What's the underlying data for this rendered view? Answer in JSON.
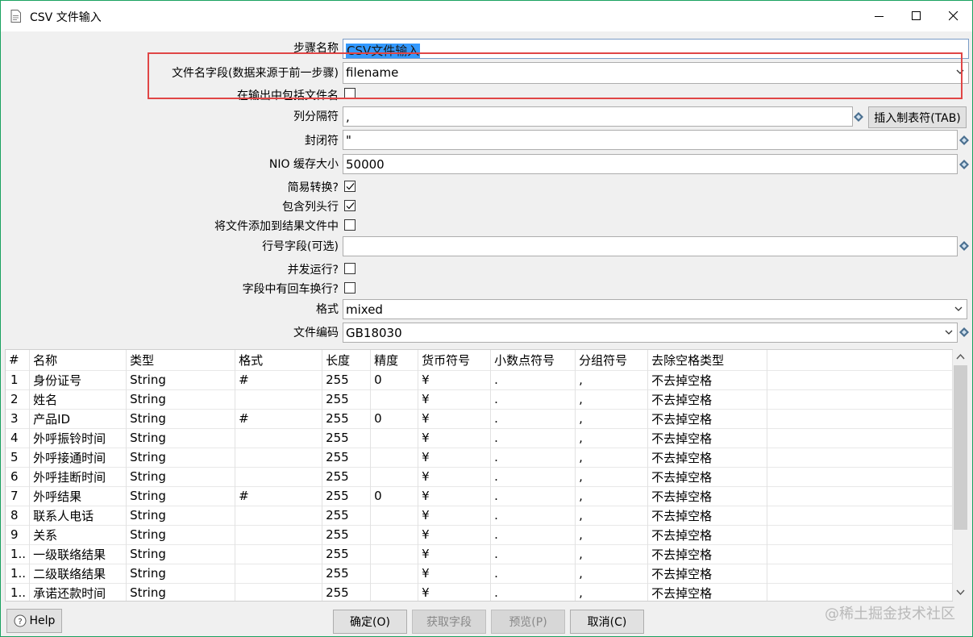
{
  "window": {
    "title": "CSV 文件输入"
  },
  "form": {
    "step_name_label": "步骤名称",
    "step_name_value": "CSV文件输入",
    "filename_field_label": "文件名字段(数据来源于前一步骤)",
    "filename_field_value": "filename",
    "include_filename_label": "在输出中包括文件名",
    "include_filename_checked": false,
    "delimiter_label": "列分隔符",
    "delimiter_value": ",",
    "insert_tab_button": "插入制表符(TAB)",
    "enclosure_label": "封闭符",
    "enclosure_value": "\"",
    "nio_buffer_label": "NIO 缓存大小",
    "nio_buffer_value": "50000",
    "lazy_conversion_label": "简易转换?",
    "lazy_conversion_checked": true,
    "header_row_label": "包含列头行",
    "header_row_checked": true,
    "add_to_result_label": "将文件添加到结果文件中",
    "add_to_result_checked": false,
    "row_number_label": "行号字段(可选)",
    "row_number_value": "",
    "parallel_label": "并发运行?",
    "parallel_checked": false,
    "newline_label": "字段中有回车换行?",
    "newline_checked": false,
    "format_label": "格式",
    "format_value": "mixed",
    "encoding_label": "文件编码",
    "encoding_value": "GB18030"
  },
  "grid": {
    "columns": [
      "#",
      "名称",
      "类型",
      "格式",
      "长度",
      "精度",
      "货币符号",
      "小数点符号",
      "分组符号",
      "去除空格类型"
    ],
    "rows": [
      [
        "1",
        "身份证号",
        "String",
        "#",
        "255",
        "0",
        "¥",
        ".",
        ",",
        "不去掉空格"
      ],
      [
        "2",
        "姓名",
        "String",
        "",
        "255",
        "",
        "¥",
        ".",
        ",",
        "不去掉空格"
      ],
      [
        "3",
        "产品ID",
        "String",
        "#",
        "255",
        "0",
        "¥",
        ".",
        ",",
        "不去掉空格"
      ],
      [
        "4",
        "外呼振铃时间",
        "String",
        "",
        "255",
        "",
        "¥",
        ".",
        ",",
        "不去掉空格"
      ],
      [
        "5",
        "外呼接通时间",
        "String",
        "",
        "255",
        "",
        "¥",
        ".",
        ",",
        "不去掉空格"
      ],
      [
        "6",
        "外呼挂断时间",
        "String",
        "",
        "255",
        "",
        "¥",
        ".",
        ",",
        "不去掉空格"
      ],
      [
        "7",
        "外呼结果",
        "String",
        "#",
        "255",
        "0",
        "¥",
        ".",
        ",",
        "不去掉空格"
      ],
      [
        "8",
        "联系人电话",
        "String",
        "",
        "255",
        "",
        "¥",
        ".",
        ",",
        "不去掉空格"
      ],
      [
        "9",
        "关系",
        "String",
        "",
        "255",
        "",
        "¥",
        ".",
        ",",
        "不去掉空格"
      ],
      [
        "1..",
        "一级联络结果",
        "String",
        "",
        "255",
        "",
        "¥",
        ".",
        ",",
        "不去掉空格"
      ],
      [
        "1..",
        "二级联络结果",
        "String",
        "",
        "255",
        "",
        "¥",
        ".",
        ",",
        "不去掉空格"
      ],
      [
        "1..",
        "承诺还款时间",
        "String",
        "",
        "255",
        "",
        "¥",
        ".",
        ",",
        "不去掉空格"
      ]
    ]
  },
  "buttons": {
    "help": "Help",
    "ok": "确定(O)",
    "get_fields": "获取字段",
    "preview": "预览(P)",
    "cancel": "取消(C)"
  },
  "watermark": "@稀土掘金技术社区"
}
